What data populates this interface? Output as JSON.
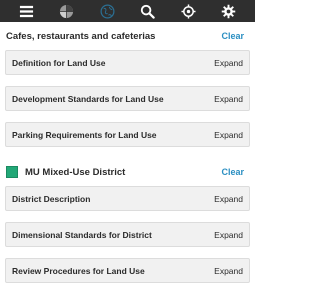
{
  "toolbar": {
    "icons": [
      "menu-icon",
      "basemap-icon",
      "globe-icon",
      "search-icon",
      "locate-icon",
      "gear-icon"
    ]
  },
  "section1": {
    "title": "Cafes, restaurants and cafeterias",
    "clear_label": "Clear",
    "rows": [
      {
        "label": "Definition for Land Use",
        "action": "Expand"
      },
      {
        "label": "Development Standards for Land Use",
        "action": "Expand"
      },
      {
        "label": "Parking Requirements for Land Use",
        "action": "Expand"
      }
    ]
  },
  "section2": {
    "title": "MU Mixed-Use District",
    "clear_label": "Clear",
    "swatch_color": "#22a877",
    "rows": [
      {
        "label": "District Description",
        "action": "Expand"
      },
      {
        "label": "Dimensional Standards for District",
        "action": "Expand"
      },
      {
        "label": "Review Procedures for Land Use",
        "action": "Expand"
      }
    ]
  },
  "colors": {
    "toolbar_bg": "#2f2f2f",
    "accent": "#2b8fc2",
    "zone_green": "#22a877"
  }
}
